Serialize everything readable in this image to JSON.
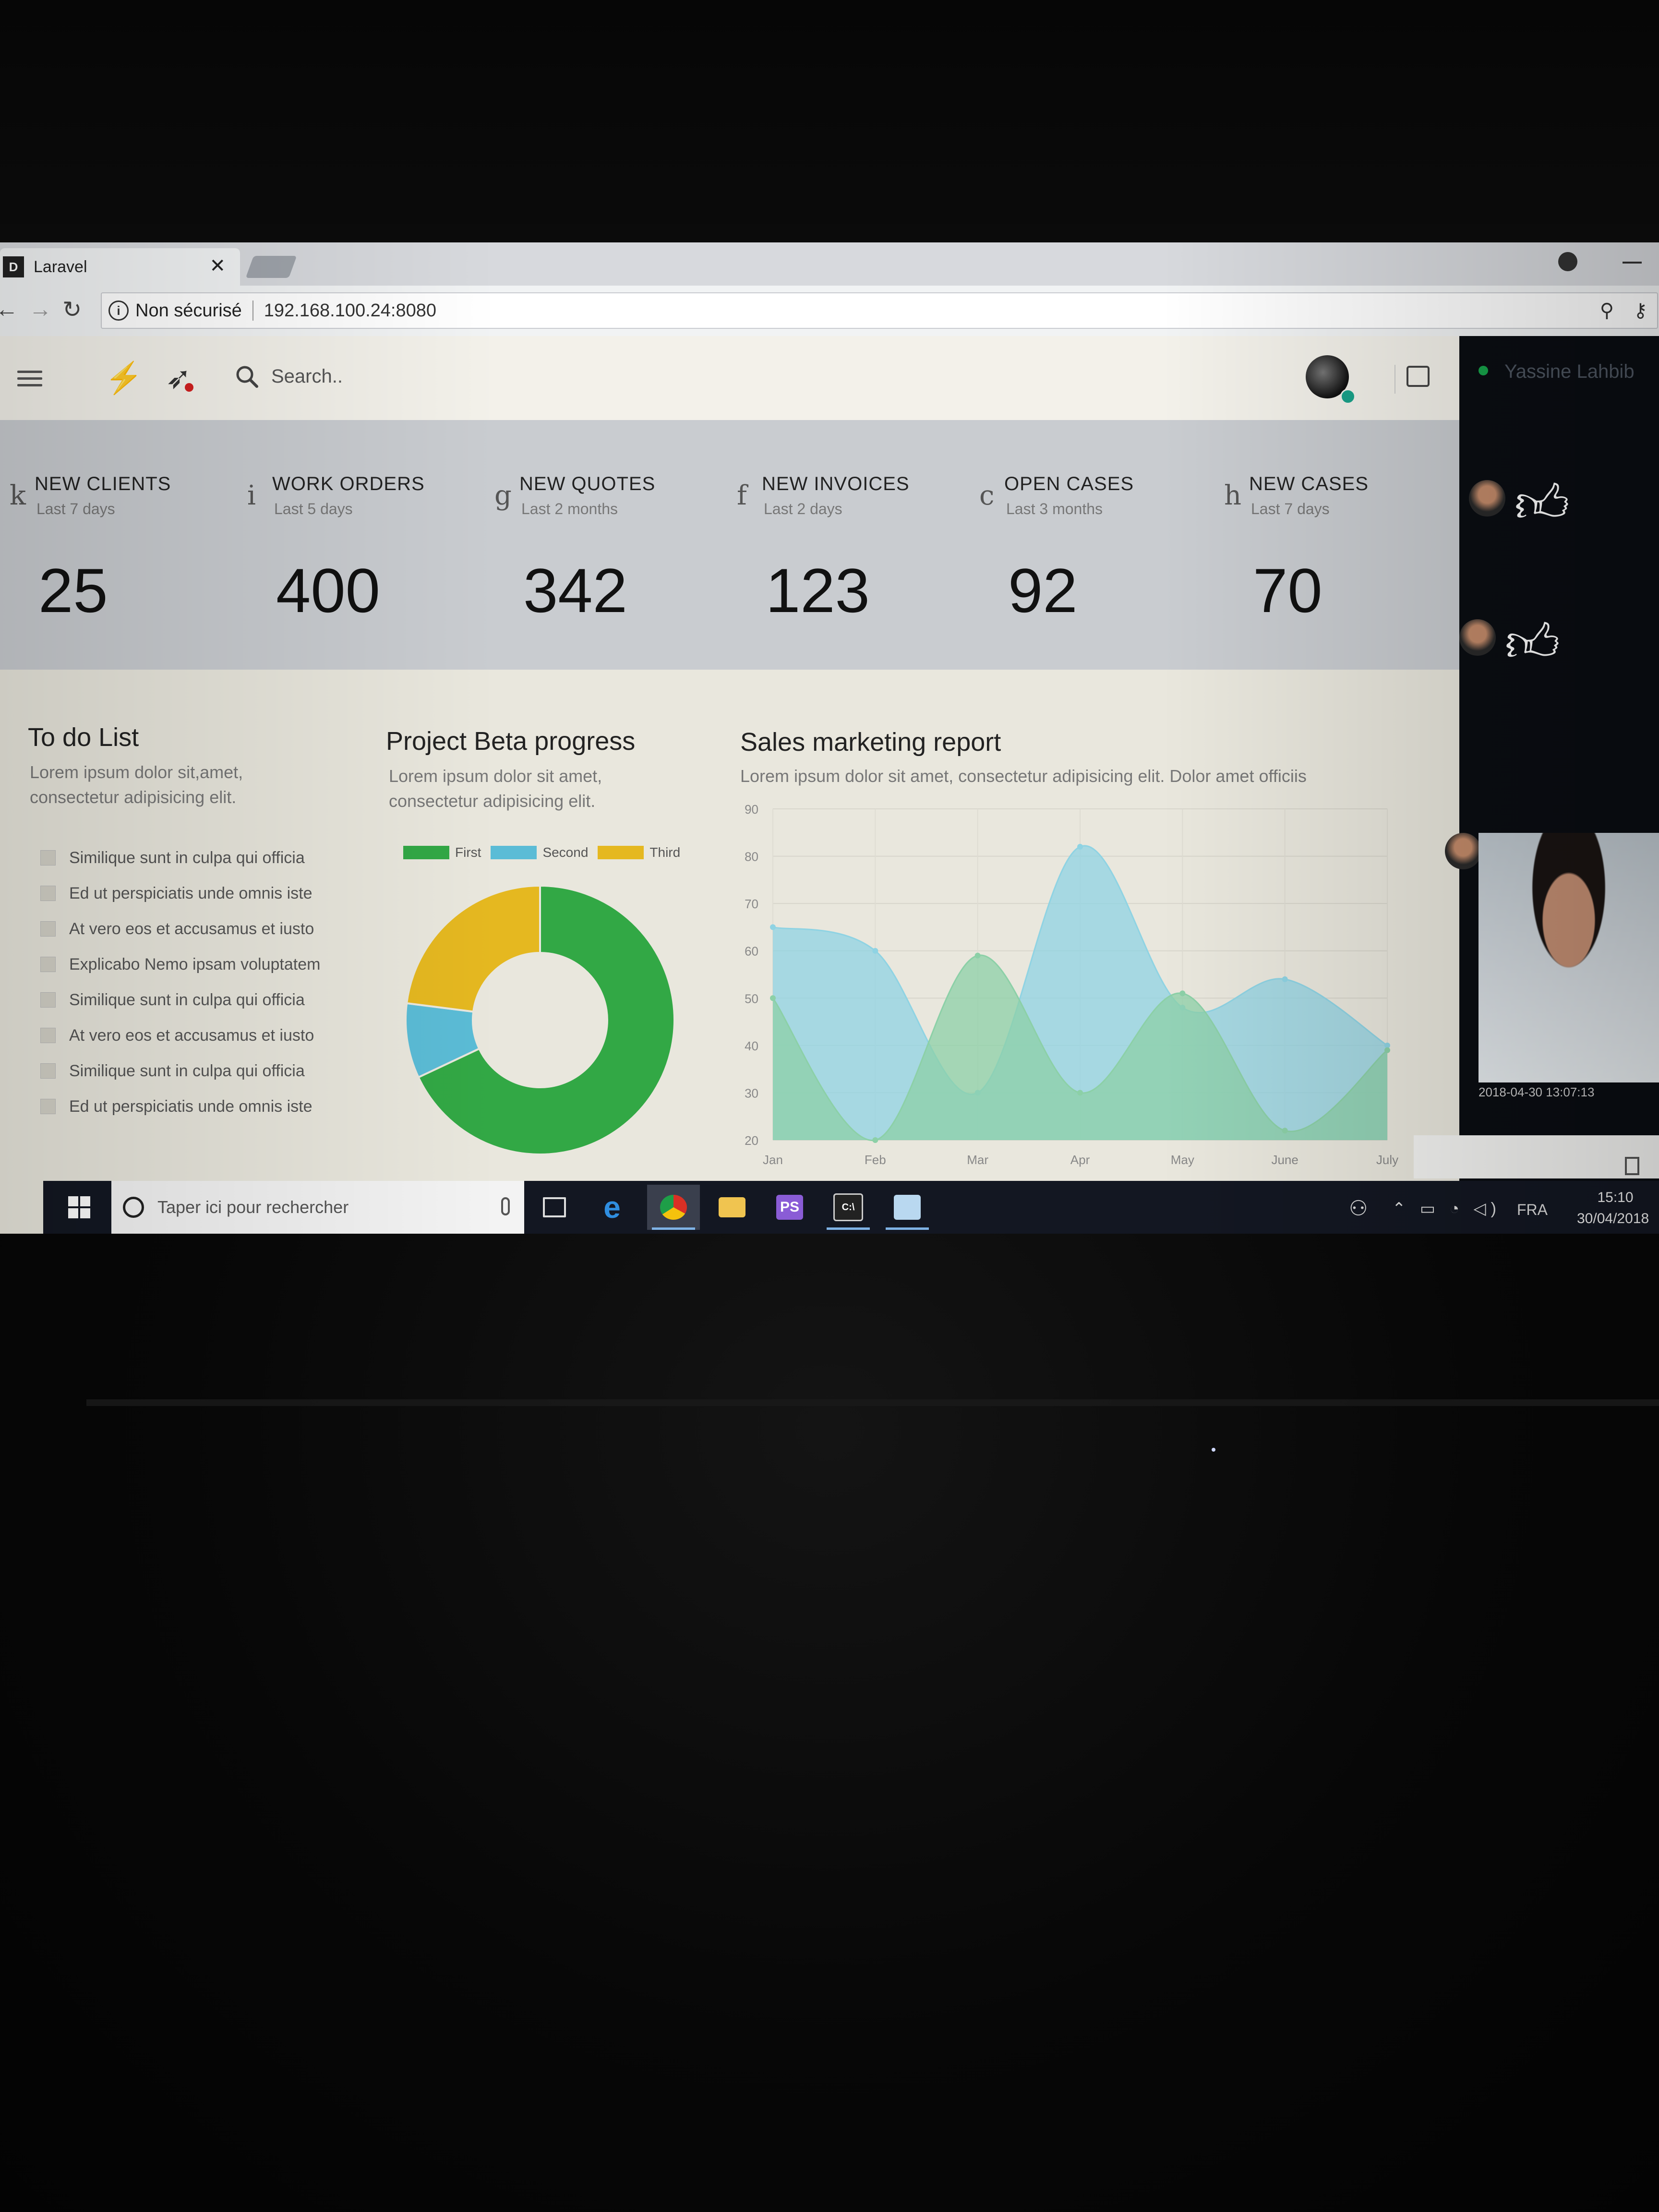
{
  "browser": {
    "tab_title": "Laravel",
    "tab_favicon": "D",
    "tab_close": "✕",
    "security_label": "Non sécurisé",
    "url": "192.168.100.24:8080"
  },
  "header": {
    "search_placeholder": "Search.."
  },
  "stats": [
    {
      "glyph": "k",
      "title": "NEW CLIENTS",
      "subtitle": "Last 7 days",
      "value": "25"
    },
    {
      "glyph": "i",
      "title": "WORK ORDERS",
      "subtitle": "Last 5 days",
      "value": "400"
    },
    {
      "glyph": "g",
      "title": "NEW QUOTES",
      "subtitle": "Last 2 months",
      "value": "342"
    },
    {
      "glyph": "f",
      "title": "NEW INVOICES",
      "subtitle": "Last 2 days",
      "value": "123"
    },
    {
      "glyph": "c",
      "title": "OPEN CASES",
      "subtitle": "Last 3 months",
      "value": "92"
    },
    {
      "glyph": "h",
      "title": "NEW CASES",
      "subtitle": "Last 7 days",
      "value": "70"
    }
  ],
  "todo": {
    "title": "To do List",
    "description": "Lorem ipsum dolor sit,amet, consectetur adipisicing elit.",
    "items": [
      "Similique sunt in culpa qui officia",
      "Ed ut perspiciatis unde omnis iste",
      "At vero eos et accusamus et iusto",
      "Explicabo Nemo ipsam voluptatem",
      "Similique sunt in culpa qui officia",
      "At vero eos et accusamus et iusto",
      "Similique sunt in culpa qui officia",
      "Ed ut perspiciatis unde omnis iste"
    ]
  },
  "beta": {
    "title": "Project Beta progress",
    "description": "Lorem ipsum dolor sit amet, consectetur adipisicing elit."
  },
  "sales": {
    "title": "Sales marketing report",
    "description": "Lorem ipsum dolor sit amet, consectetur adipisicing elit. Dolor amet officiis"
  },
  "chart_data": [
    {
      "type": "pie",
      "variant": "doughnut",
      "legend_position": "top",
      "labels": [
        "First",
        "Second",
        "Third"
      ],
      "values": [
        68,
        9,
        23
      ],
      "colors": [
        "#32a845",
        "#5bbcd6",
        "#e5b820"
      ]
    },
    {
      "type": "area",
      "categories": [
        "Jan",
        "Feb",
        "Mar",
        "Apr",
        "May",
        "June",
        "July"
      ],
      "ylim": [
        20,
        90
      ],
      "yticks": [
        "90",
        "80",
        "70",
        "60",
        "50",
        "40",
        "30",
        "20"
      ],
      "grid": true,
      "series": [
        {
          "values": [
            65,
            60,
            30,
            82,
            48,
            54,
            40
          ],
          "color": "#8fd3e3"
        },
        {
          "values": [
            50,
            20,
            59,
            30,
            51,
            22,
            39
          ],
          "color": "#8cd0a7"
        }
      ]
    }
  ],
  "sidebar": {
    "user_name": "Yassine Lahbib",
    "video_timestamp": "2018-04-30 13:07:13"
  },
  "taskbar": {
    "search_placeholder": "Taper ici pour rechercher",
    "language": "FRA",
    "time": "15:10",
    "date": "30/04/2018"
  }
}
